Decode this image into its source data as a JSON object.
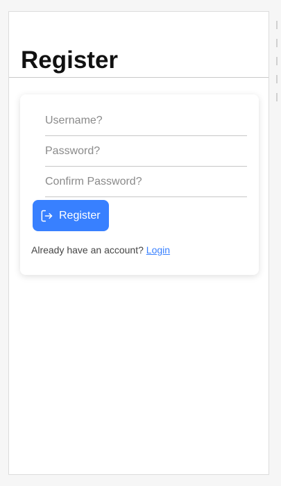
{
  "page": {
    "title": "Register"
  },
  "form": {
    "username": {
      "value": "",
      "placeholder": "Username?"
    },
    "password": {
      "value": "",
      "placeholder": "Password?"
    },
    "confirm_password": {
      "value": "",
      "placeholder": "Confirm Password?"
    },
    "submit_label": "Register",
    "submit_icon": "log-in-icon"
  },
  "footer": {
    "prompt": "Already have an account? ",
    "link_label": "Login"
  },
  "colors": {
    "accent": "#3880ff",
    "background": "#ffffff",
    "divider": "#c6c6c6"
  }
}
